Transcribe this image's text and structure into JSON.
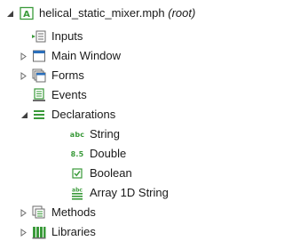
{
  "tree": {
    "root": {
      "label": "helical_static_mixer.mph",
      "note": "(root)",
      "icon": "model-root-icon",
      "expanded": true
    },
    "items": [
      {
        "label": "Inputs",
        "icon": "inputs-icon"
      },
      {
        "label": "Main Window",
        "icon": "window-icon",
        "expandable": true
      },
      {
        "label": "Forms",
        "icon": "forms-icon",
        "expandable": true
      },
      {
        "label": "Events",
        "icon": "events-icon"
      },
      {
        "label": "Declarations",
        "icon": "declarations-icon",
        "expanded": true,
        "children": [
          {
            "label": "String",
            "icon": "string-icon",
            "glyph": "abc"
          },
          {
            "label": "Double",
            "icon": "double-icon",
            "glyph": "8.5"
          },
          {
            "label": "Boolean",
            "icon": "boolean-icon"
          },
          {
            "label": "Array 1D String",
            "icon": "array-string-icon"
          }
        ]
      },
      {
        "label": "Methods",
        "icon": "methods-icon",
        "expandable": true
      },
      {
        "label": "Libraries",
        "icon": "libraries-icon",
        "expandable": true
      }
    ]
  },
  "colors": {
    "accent": "#3a9a3a",
    "icon_gray": "#6b6b6b",
    "window_blue": "#2a6ebb"
  }
}
